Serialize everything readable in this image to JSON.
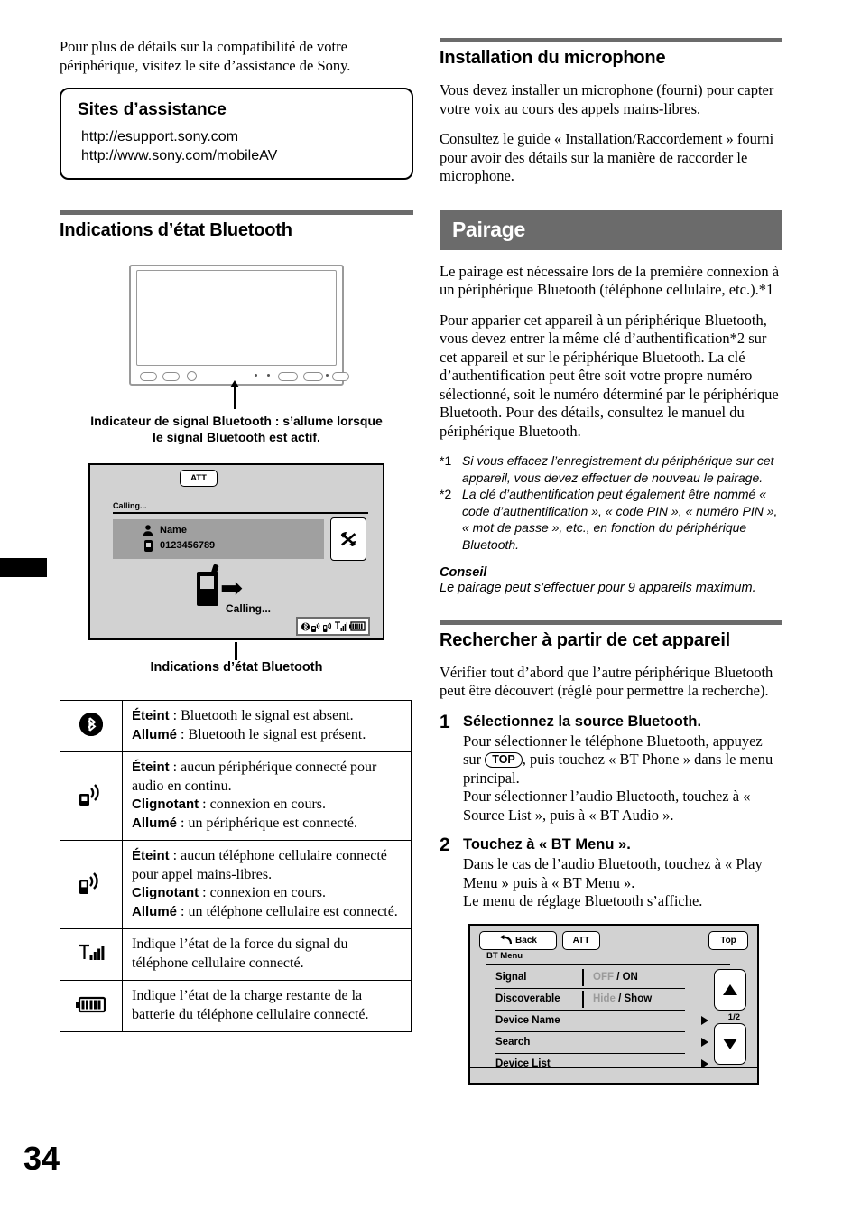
{
  "page": {
    "number": "34"
  },
  "left_column": {
    "intro_paragraph": "Pour plus de détails sur la compatibilité de votre périphérique, visitez le site d’assistance de Sony.",
    "support_box": {
      "title": "Sites d’assistance",
      "url1": "http://esupport.sony.com",
      "url2": "http://www.sony.com/mobileAV"
    },
    "section_title": "Indications d’état Bluetooth",
    "unit_caption": "Indicateur de signal Bluetooth : s’allume lorsque le signal Bluetooth est actif.",
    "calling_screen": {
      "att_label": "ATT",
      "calling_label": "Calling...",
      "contact_name": "Name",
      "contact_number": "0123456789",
      "end_call_icon": "call-end-icon",
      "calling_status": "Calling...",
      "status_icons": [
        "bluetooth-icon",
        "audio-streaming-icon",
        "handsfree-icon",
        "signal-strength-icon",
        "battery-icon"
      ],
      "caption": "Indications d’état Bluetooth"
    },
    "indicator_table": {
      "rows": [
        {
          "icon": "bluetooth-icon",
          "lines": [
            {
              "bold": "Éteint",
              "rest": " : Bluetooth le signal est absent."
            },
            {
              "bold": "Allumé",
              "rest": " : Bluetooth le signal est présent."
            }
          ]
        },
        {
          "icon": "audio-streaming-icon",
          "lines": [
            {
              "bold": "Éteint",
              "rest": " : aucun périphérique connecté pour audio en continu."
            },
            {
              "bold": "Clignotant",
              "rest": " : connexion en cours."
            },
            {
              "bold": "Allumé",
              "rest": " : un périphérique est connecté."
            }
          ]
        },
        {
          "icon": "handsfree-icon",
          "lines": [
            {
              "bold": "Éteint",
              "rest": " : aucun téléphone cellulaire connecté pour appel mains-libres."
            },
            {
              "bold": "Clignotant",
              "rest": " : connexion en cours."
            },
            {
              "bold": "Allumé",
              "rest": " : un téléphone cellulaire est connecté."
            }
          ]
        },
        {
          "icon": "signal-strength-icon",
          "lines": [
            {
              "bold": "",
              "rest": "Indique l’état de la force du signal du téléphone cellulaire connecté."
            }
          ]
        },
        {
          "icon": "battery-icon",
          "lines": [
            {
              "bold": "",
              "rest": "Indique l’état de la charge restante de la batterie du téléphone cellulaire connecté."
            }
          ]
        }
      ]
    }
  },
  "right_column": {
    "mic_section": {
      "title": "Installation du microphone",
      "paragraph1": "Vous devez installer un microphone (fourni) pour capter votre voix au cours des appels mains-libres.",
      "paragraph2": "Consultez le guide « Installation/Raccordement » fourni pour avoir des détails sur la manière de raccorder le microphone."
    },
    "pairing_banner": "Pairage",
    "pairing": {
      "paragraph1": "Le pairage est nécessaire lors de la première connexion à un périphérique Bluetooth (téléphone cellulaire, etc.).*1",
      "paragraph2": "Pour apparier cet appareil à un périphérique Bluetooth, vous devez entrer la même clé d’authentification*2 sur cet appareil et sur le périphérique Bluetooth. La clé d’authentification peut être soit votre propre numéro sélectionné, soit le numéro déterminé par le périphérique Bluetooth. Pour des détails, consultez le manuel du périphérique Bluetooth.",
      "footnote1_marker": "*1",
      "footnote1": "Si vous effacez l’enregistrement du périphérique sur cet appareil, vous devez effectuer de nouveau le pairage.",
      "footnote2_marker": "*2",
      "footnote2": "La clé d’authentification peut également être nommé « code d’authentification », « code PIN », « numéro PIN », « mot de passe », etc., en fonction du périphérique Bluetooth.",
      "tip_title": "Conseil",
      "tip_body": "Le pairage peut s’effectuer pour 9 appareils maximum."
    },
    "search_section": {
      "title": "Rechercher à partir de cet appareil",
      "intro": "Vérifier tout d’abord que l’autre périphérique Bluetooth peut être découvert (réglé pour permettre la recherche).",
      "steps": [
        {
          "num": "1",
          "title": "Sélectionnez la source Bluetooth.",
          "text_before_key": "Pour sélectionner le téléphone Bluetooth, appuyez sur ",
          "key": "TOP",
          "text_after_key": ", puis touchez « BT Phone » dans le menu principal.",
          "text_line2": "Pour sélectionner l’audio Bluetooth, touchez à « Source List », puis à « BT Audio »."
        },
        {
          "num": "2",
          "title": "Touchez à « BT Menu ».",
          "text_before_key": "Dans le cas de l’audio Bluetooth, touchez à « Play Menu » puis à « BT Menu ».",
          "key": "",
          "text_after_key": "",
          "text_line2": "Le menu de réglage Bluetooth s’affiche."
        }
      ]
    },
    "bt_menu_screen": {
      "back_label": "Back",
      "att_label": "ATT",
      "top_label": "Top",
      "menu_label": "BT Menu",
      "page_indicator": "1/2",
      "rows": [
        {
          "label": "Signal",
          "value_dim": "OFF",
          "value_sep": " / ",
          "value_on": "ON",
          "has_arrow": false
        },
        {
          "label": "Discoverable",
          "value_dim": "Hide",
          "value_sep": " / ",
          "value_on": "Show",
          "has_arrow": false
        },
        {
          "label": "Device Name",
          "value_dim": "",
          "value_sep": "",
          "value_on": "",
          "has_arrow": true
        },
        {
          "label": "Search",
          "value_dim": "",
          "value_sep": "",
          "value_on": "",
          "has_arrow": true
        },
        {
          "label": "Device List",
          "value_dim": "",
          "value_sep": "",
          "value_on": "",
          "has_arrow": true
        }
      ]
    }
  },
  "colors": {
    "rule_gray": "#6b6b6b",
    "banner_gray": "#6b6b6b",
    "screen_gray": "#d2d2d2",
    "row_gray": "#a0a0a0",
    "dim_text": "#9a9a9a"
  }
}
